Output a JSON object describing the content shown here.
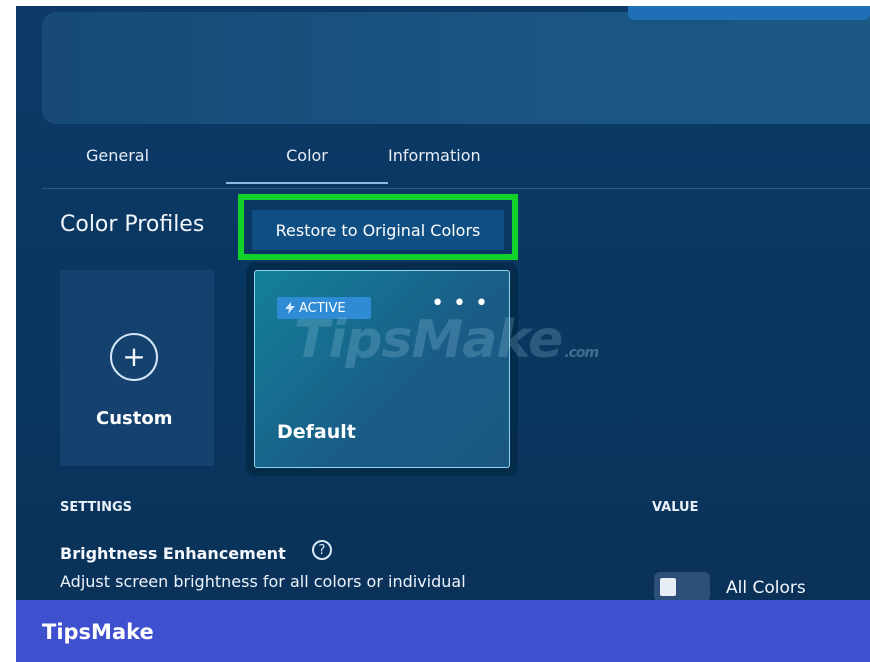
{
  "tabs": {
    "items": [
      "General",
      "Color",
      "Information"
    ]
  },
  "color_profiles": {
    "title": "Color Profiles",
    "restore_button": "Restore to Original Colors",
    "custom_card_label": "Custom",
    "default_card": {
      "badge": "ACTIVE",
      "label": "Default",
      "menu": "• • •"
    }
  },
  "settings": {
    "header": "SETTINGS",
    "value_header": "VALUE",
    "brightness": {
      "title": "Brightness Enhancement",
      "help_icon": "?",
      "description": "Adjust screen brightness for all colors or individual",
      "value_label": "All Colors"
    }
  },
  "watermark": {
    "main": "TipsMake",
    "suffix": ".com"
  },
  "footer": {
    "brand": "TipsMake"
  },
  "colors": {
    "highlight": "#12d128",
    "footer": "#3f50cf",
    "accent": "#2f8bd3"
  }
}
